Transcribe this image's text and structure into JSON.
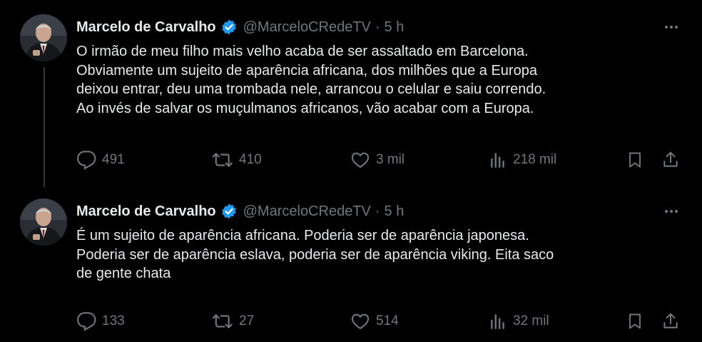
{
  "tweets": [
    {
      "author_name": "Marcelo de Carvalho",
      "handle": "@MarceloCRedeTV",
      "separator": "·",
      "time": "5 h",
      "text": "O irmão de meu filho mais velho acaba de ser assaltado em Barcelona.\nObviamente um sujeito de aparência africana, dos milhões que a Europa\ndeixou entrar, deu uma trombada nele, arrancou o celular e saiu correndo.\nAo invés de salvar os muçulmanos africanos, vão acabar com a Europa.",
      "replies": "491",
      "retweets": "410",
      "likes": "3 mil",
      "views": "218 mil"
    },
    {
      "author_name": "Marcelo de Carvalho",
      "handle": "@MarceloCRedeTV",
      "separator": "·",
      "time": "5 h",
      "text": "É um sujeito de aparência africana. Poderia ser de aparência japonesa.\nPoderia ser de aparência eslava, poderia ser de aparência viking. Eita saco\nde gente chata",
      "replies": "133",
      "retweets": "27",
      "likes": "514",
      "views": "32 mil"
    }
  ],
  "colors": {
    "background": "#000000",
    "primary_text": "#e7e9ea",
    "secondary_text": "#71767b",
    "verified_badge": "#1d9bf0",
    "thread_line": "#333639"
  },
  "icons": [
    "verified-badge-icon",
    "more-icon",
    "reply-icon",
    "retweet-icon",
    "like-icon",
    "views-icon",
    "bookmark-icon",
    "share-icon"
  ]
}
